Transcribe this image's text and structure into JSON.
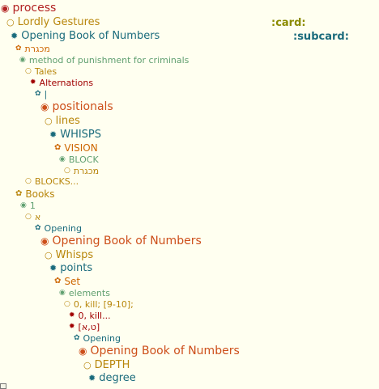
{
  "outline": {
    "rows": [
      {
        "label": "process",
        "icon": "filled-circle-icon",
        "color": "#b22222"
      },
      {
        "label": "Lordly Gestures",
        "icon": "open-circle-icon",
        "color": "#b8860b"
      },
      {
        "label": "Opening Book of Numbers",
        "icon": "asterisk-icon",
        "color": "#1a6b7c"
      },
      {
        "label": "מכגרת",
        "icon": "flower-icon",
        "color": "#cd6600"
      },
      {
        "label": "method of punishment for criminals",
        "icon": "filled-circle-icon",
        "color": "#5f9f6f"
      },
      {
        "label": "Tales",
        "icon": "open-circle-icon",
        "color": "#b8860b"
      },
      {
        "label": "Alternations",
        "icon": "asterisk-icon",
        "color": "#a00000"
      },
      {
        "label": "|",
        "icon": "flower-icon",
        "color": "#1a6b7c"
      },
      {
        "label": "positionals",
        "icon": "filled-circle-icon",
        "color": "#cd4f1a"
      },
      {
        "label": "lines",
        "icon": "open-circle-icon",
        "color": "#b8860b"
      },
      {
        "label": "WHISPS",
        "icon": "asterisk-icon",
        "color": "#1a6b7c"
      },
      {
        "label": "VISION",
        "icon": "flower-icon",
        "color": "#cd6600"
      },
      {
        "label": "BLOCK",
        "icon": "filled-circle-icon",
        "color": "#5f9f6f"
      },
      {
        "label": "מכגרת",
        "icon": "open-circle-icon",
        "color": "#b8860b"
      },
      {
        "label": "BLOCKS...",
        "icon": "open-circle-icon",
        "color": "#b8860b"
      },
      {
        "label": "Books",
        "icon": "flower-icon",
        "color": "#b8860b"
      },
      {
        "label": "1",
        "icon": "filled-circle-icon",
        "color": "#5f9f6f"
      },
      {
        "label": "א",
        "icon": "open-circle-icon",
        "color": "#b8860b"
      },
      {
        "label": "Opening",
        "icon": "flower-icon",
        "color": "#1a6b7c"
      },
      {
        "label": "Opening Book of Numbers",
        "icon": "filled-circle-icon",
        "color": "#cd4f1a"
      },
      {
        "label": "Whisps",
        "icon": "open-circle-icon",
        "color": "#b8860b"
      },
      {
        "label": "points",
        "icon": "asterisk-icon",
        "color": "#1a6b7c"
      },
      {
        "label": "Set",
        "icon": "flower-icon",
        "color": "#cd6600"
      },
      {
        "label": "elements",
        "icon": "filled-circle-icon",
        "color": "#5f9f6f"
      },
      {
        "label": "0, kill; [9-10];",
        "icon": "open-circle-icon",
        "color": "#b8860b"
      },
      {
        "label": "0, kill...",
        "icon": "asterisk-icon",
        "color": "#a00000"
      },
      {
        "label": "[ט,א]",
        "icon": "asterisk-icon",
        "color": "#a00000"
      },
      {
        "label": "Opening",
        "icon": "flower-icon",
        "color": "#1a6b7c"
      },
      {
        "label": "Opening Book of Numbers",
        "icon": "filled-circle-icon",
        "color": "#cd4f1a"
      },
      {
        "label": "DEPTH",
        "icon": "open-circle-icon",
        "color": "#b8860b"
      },
      {
        "label": "degree",
        "icon": "asterisk-icon",
        "color": "#1a6b7c"
      }
    ]
  },
  "tags": {
    "card": ":card:",
    "subcard": ":subcard:"
  }
}
